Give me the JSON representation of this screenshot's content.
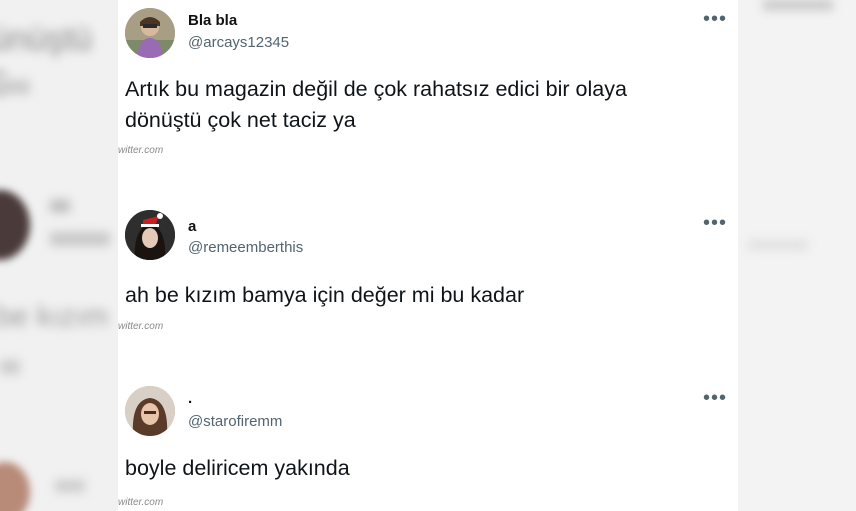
{
  "tweets": [
    {
      "name": "Bla bla",
      "handle": "@arcays12345",
      "text_line1": "Artık bu magazin değil de çok rahatsız edici bir olaya",
      "text_line2": "dönüştü çok net taciz ya",
      "source": "witter.com",
      "more": "•••"
    },
    {
      "name": "a",
      "handle": "@remeemberthis",
      "text_line1": "ah be kızım bamya için değer mi bu kadar",
      "source": "witter.com",
      "more": "•••"
    },
    {
      "name": ".",
      "handle": "@starofiremm",
      "text_line1": "boyle deliricem yakında",
      "source": "witter.com",
      "more": "•••"
    }
  ]
}
